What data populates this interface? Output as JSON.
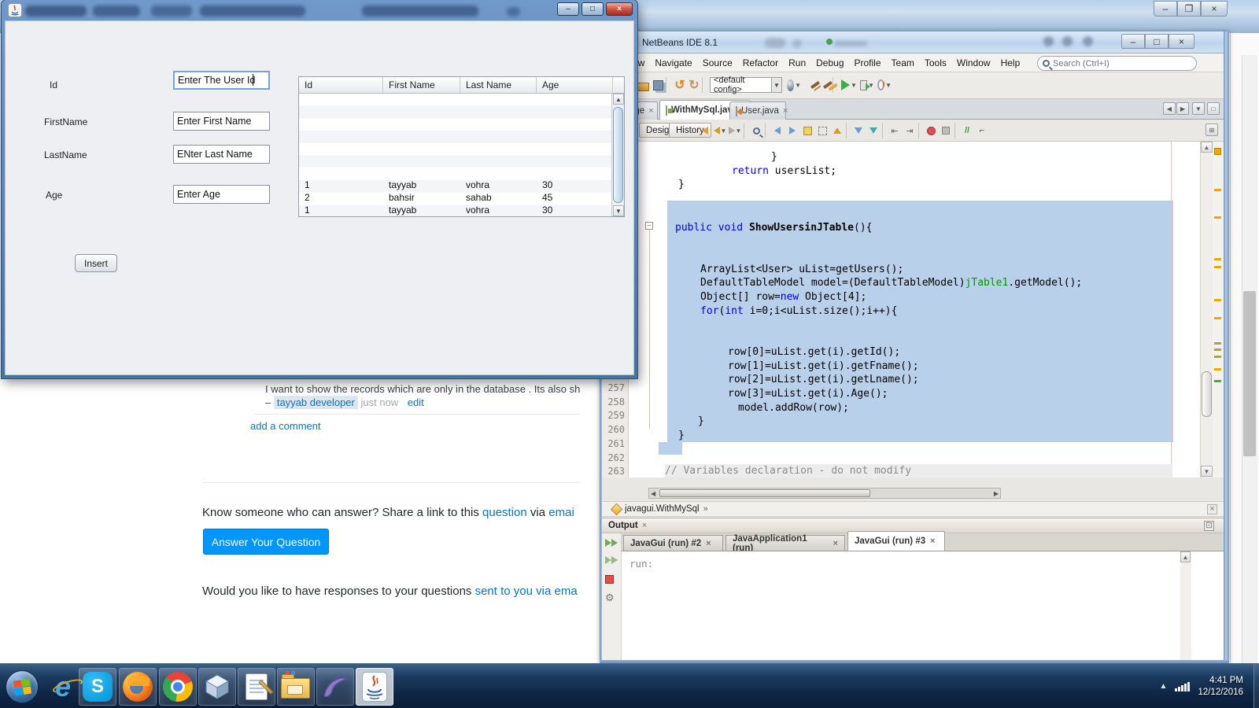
{
  "icons": {
    "minimize": "–",
    "maximize": "□",
    "restore": "❐",
    "close": "×",
    "up": "▲",
    "down": "▼",
    "left": "◀",
    "right": "▶",
    "chevron": "»",
    "gear": "⚙",
    "undo": "↺",
    "redo": "↻",
    "dropdown": "▼"
  },
  "java_app": {
    "form": {
      "fields": [
        {
          "label": "Id",
          "value": "Enter The User Id",
          "focused": true
        },
        {
          "label": "FirstName",
          "value": "Enter First Name",
          "focused": false
        },
        {
          "label": "LastName",
          "value": "ENter Last Name",
          "focused": false
        },
        {
          "label": "Age",
          "value": "Enter Age",
          "focused": false
        }
      ],
      "insert_button": "Insert"
    },
    "table": {
      "columns": [
        "Id",
        "First Name",
        "Last Name",
        "Age"
      ],
      "rows": [
        [
          "1",
          "tayyab",
          "vohra",
          "30"
        ],
        [
          "2",
          "bahsir",
          "sahab",
          "45"
        ],
        [
          "1",
          "tayyab",
          "vohra",
          "30"
        ]
      ]
    }
  },
  "browser": {
    "comment": {
      "text": "I want to show the records which are only in the database . Its also sh",
      "dash": "–",
      "author": "tayyab developer",
      "time": "just now",
      "edit": "edit"
    },
    "add_comment": "add a comment",
    "share": {
      "prefix": "Know someone who can answer? Share a link to this ",
      "question_link": "question",
      "middle": " via ",
      "email_link": "emai"
    },
    "answer_button": "Answer Your Question",
    "responses": {
      "prefix": "Would you like to have responses to your questions ",
      "link": "sent to you via ema"
    }
  },
  "netbeans": {
    "title": "NetBeans IDE 8.1",
    "menu": [
      "ew",
      "Navigate",
      "Source",
      "Refactor",
      "Run",
      "Debug",
      "Profile",
      "Team",
      "Tools",
      "Window",
      "Help"
    ],
    "search_placeholder": "Search (Ctrl+I)",
    "toolbar": {
      "config_value": "<default config>",
      "icon_names": [
        "open-project-icon",
        "save-all-icon",
        "undo-icon",
        "redo-icon",
        "deploy-icon",
        "build-project-icon",
        "clean-build-icon",
        "run-project-icon",
        "debug-project-icon",
        "profile-project-icon"
      ]
    },
    "editor_tabs": [
      {
        "label": "age",
        "active": false
      },
      {
        "label": "WithMySql.java",
        "active": true
      },
      {
        "label": "User.java",
        "active": false
      }
    ],
    "view_buttons": [
      "Design",
      "History"
    ],
    "editor_toolbar_icon_names": [
      "last-edit-icon",
      "back-icon",
      "forward-icon",
      "find-icon",
      "prev-occurrence-icon",
      "next-occurrence-icon",
      "toggle-highlight-icon",
      "select-rect-icon",
      "prev-bookmark-icon",
      "next-bookmark-icon",
      "next-error-icon",
      "shift-left-icon",
      "shift-right-icon",
      "breakpoint-icon",
      "stop-macro-icon",
      "comment-icon",
      "uncomment-icon"
    ],
    "gutter_lines": [
      "257",
      "258",
      "259",
      "260",
      "261",
      "262",
      "263"
    ],
    "code_lines": [
      {
        "seg": [
          [
            "}",
            "pl"
          ]
        ]
      },
      {
        "seg": [
          [
            "return",
            "kw"
          ],
          [
            " usersList;",
            "pl"
          ]
        ]
      },
      {
        "seg": [
          [
            "}",
            "pl"
          ]
        ]
      },
      {
        "seg": [
          [
            "public",
            "kw"
          ],
          [
            " ",
            "pl"
          ],
          [
            "void",
            "kw"
          ],
          [
            " ",
            "pl"
          ],
          [
            "ShowUsersinJTable",
            "me"
          ],
          [
            "(){",
            "pl"
          ]
        ]
      },
      {
        "seg": [
          [
            "ArrayList<User> uList=getUsers();",
            "pl"
          ]
        ]
      },
      {
        "seg": [
          [
            "DefaultTableModel model=(DefaultTableModel)",
            "pl"
          ],
          [
            "jTable1",
            "gr"
          ],
          [
            ".getModel();",
            "pl"
          ]
        ]
      },
      {
        "seg": [
          [
            "Object[] row=",
            "pl"
          ],
          [
            "new",
            "kw"
          ],
          [
            " Object[4];",
            "pl"
          ]
        ]
      },
      {
        "seg": [
          [
            "for",
            "kw"
          ],
          [
            "(",
            "pl"
          ],
          [
            "int",
            "kw"
          ],
          [
            " i=0;i<uList.size();i++){",
            "pl"
          ]
        ]
      },
      {
        "seg": [
          [
            "row[0]=uList.get(i).getId();",
            "pl"
          ]
        ]
      },
      {
        "seg": [
          [
            "row[1]=uList.get(i).getFname();",
            "pl"
          ]
        ]
      },
      {
        "seg": [
          [
            "row[2]=uList.get(i).getLname();",
            "pl"
          ]
        ]
      },
      {
        "seg": [
          [
            "row[3]=uList.get(i).Age();",
            "pl"
          ]
        ]
      },
      {
        "seg": [
          [
            "model.addRow(row);",
            "pl"
          ]
        ]
      },
      {
        "seg": [
          [
            "}",
            "pl"
          ]
        ]
      },
      {
        "seg": [
          [
            "}",
            "pl"
          ]
        ]
      },
      {
        "seg": [
          [
            "// Variables declaration - do not modify",
            "cm"
          ]
        ],
        "band": true
      }
    ],
    "breadcrumb": "javagui.WithMySql",
    "output": {
      "label": "Output",
      "tabs": [
        {
          "label": "JavaGui (run) #2",
          "active": false
        },
        {
          "label": "JavaApplication1 (run)",
          "active": false
        },
        {
          "label": "JavaGui (run) #3",
          "active": true
        }
      ],
      "rail_icon_names": [
        "rerun-icon",
        "rerun-stopped-icon",
        "stop-run-icon",
        "run-settings-icon"
      ],
      "text": "run:"
    }
  },
  "taskbar": {
    "icon_names": [
      "start-button",
      "internet-explorer-icon",
      "skype-icon",
      "firefox-icon",
      "chrome-icon",
      "netbeans-icon",
      "notepad-icon",
      "file-explorer-icon",
      "mysql-workbench-icon",
      "java-app-icon"
    ],
    "tray": {
      "time": "4:41 PM",
      "date": "12/12/2016"
    }
  },
  "colors": {
    "so_button_blue": "#0095ff",
    "so_link_blue": "#0077cc",
    "selection_blue": "#b9d0ea",
    "keyword_blue": "#0000e6",
    "identifier_green": "#009900",
    "stripe_orange": "#f0a500"
  }
}
